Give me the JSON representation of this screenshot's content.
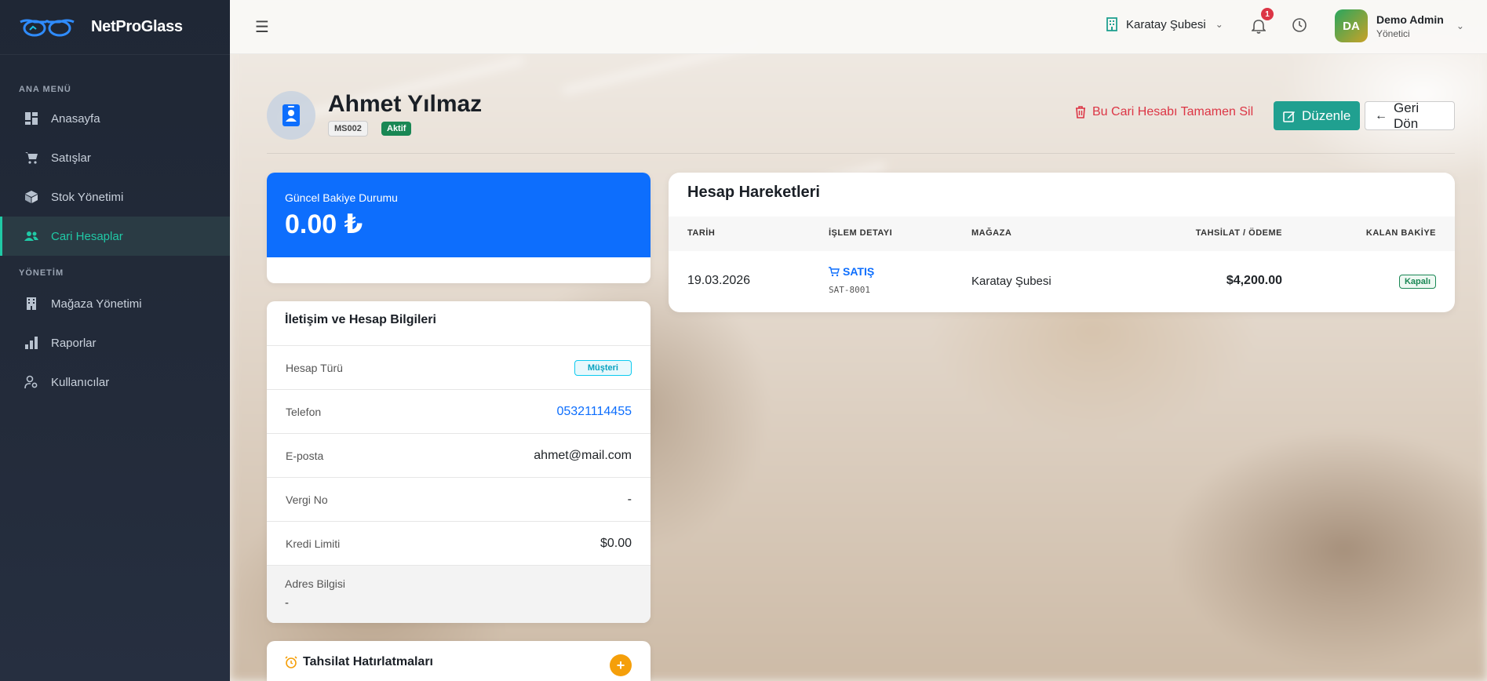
{
  "brand": {
    "name": "NetProGlass"
  },
  "sidebar": {
    "section_main": "ANA MENÜ",
    "section_admin": "YÖNETİM",
    "items": [
      {
        "label": "Anasayfa",
        "icon": "dashboard-icon"
      },
      {
        "label": "Satışlar",
        "icon": "cart-icon"
      },
      {
        "label": "Stok Yönetimi",
        "icon": "box-icon"
      },
      {
        "label": "Cari Hesaplar",
        "icon": "people-icon",
        "active": true
      },
      {
        "label": "Mağaza Yönetimi",
        "icon": "building-icon"
      },
      {
        "label": "Raporlar",
        "icon": "bar-chart-icon"
      },
      {
        "label": "Kullanıcılar",
        "icon": "user-gear-icon"
      }
    ]
  },
  "topbar": {
    "branch": "Karatay Şubesi",
    "notification_count": "1",
    "user": {
      "initials": "DA",
      "name": "Demo Admin",
      "role": "Yönetici"
    }
  },
  "header": {
    "name": "Ahmet Yılmaz",
    "code": "MS002",
    "status": "Aktif",
    "delete_label": "Bu Cari Hesabı Tamamen Sil",
    "edit_label": "Düzenle",
    "back_label": "Geri Dön"
  },
  "balance": {
    "label": "Güncel Bakiye Durumu",
    "value": "0.00 ₺"
  },
  "info": {
    "title": "İletişim ve Hesap Bilgileri",
    "rows": [
      {
        "label": "Hesap Türü",
        "value": "Müşteri"
      },
      {
        "label": "Telefon",
        "value": "05321114455"
      },
      {
        "label": "E-posta",
        "value": "ahmet@mail.com"
      },
      {
        "label": "Vergi No",
        "value": "-"
      },
      {
        "label": "Kredi Limiti",
        "value": "$0.00"
      }
    ],
    "address_label": "Adres Bilgisi",
    "address_value": "-"
  },
  "reminders": {
    "title": "Tahsilat Hatırlatmaları",
    "add_label": "+"
  },
  "transactions": {
    "title": "Hesap Hareketleri",
    "columns": [
      "TARİH",
      "İŞLEM DETAYI",
      "MAĞAZA",
      "TAHSİLAT / ÖDEME",
      "KALAN BAKİYE"
    ],
    "rows": [
      {
        "date": "19.03.2026",
        "type": "SATIŞ",
        "ref": "SAT-8001",
        "store": "Karatay Şubesi",
        "amount": "$4,200.00",
        "status": "Kapalı"
      }
    ]
  },
  "colors": {
    "accent": "#20c9a6",
    "primary": "#0d6efd",
    "danger": "#dc3545",
    "success": "#198754"
  }
}
